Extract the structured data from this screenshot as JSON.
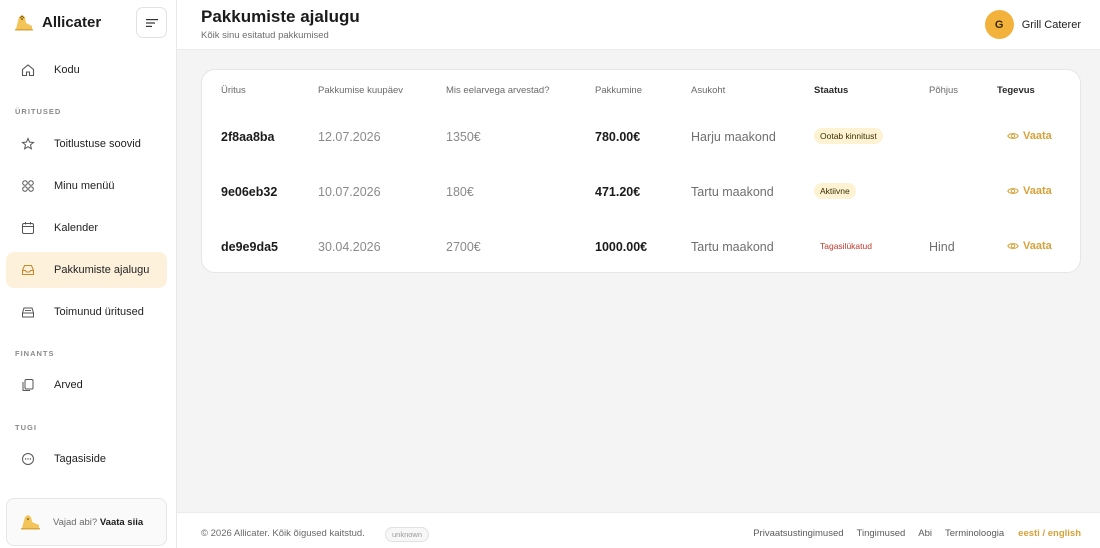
{
  "app": {
    "name": "Allicater"
  },
  "sidebar": {
    "items_top": [
      {
        "label": "Kodu",
        "icon": "home-icon"
      }
    ],
    "sections": [
      {
        "label": "ÜRITUSED",
        "items": [
          {
            "label": "Toitlustuse soovid",
            "icon": "star-icon"
          },
          {
            "label": "Minu menüü",
            "icon": "grid-icon"
          },
          {
            "label": "Kalender",
            "icon": "calendar-icon"
          },
          {
            "label": "Pakkumiste ajalugu",
            "icon": "inbox-icon",
            "active": true
          },
          {
            "label": "Toimunud üritused",
            "icon": "archive-icon"
          }
        ]
      },
      {
        "label": "FINANTS",
        "items": [
          {
            "label": "Arved",
            "icon": "copy-icon"
          }
        ]
      },
      {
        "label": "TUGI",
        "items": [
          {
            "label": "Tagasiside",
            "icon": "chat-icon"
          }
        ]
      }
    ],
    "help": {
      "prefix": "Vajad abi?",
      "link": "Vaata siia"
    }
  },
  "header": {
    "title": "Pakkumiste ajalugu",
    "subtitle": "Kõik sinu esitatud pakkumised",
    "user": {
      "initial": "G",
      "name": "Grill Caterer"
    }
  },
  "table": {
    "columns": [
      "Üritus",
      "Pakkumise kuupäev",
      "Mis eelarvega arvestad?",
      "Pakkumine",
      "Asukoht",
      "Staatus",
      "Põhjus",
      "Tegevus"
    ],
    "rows": [
      {
        "event": "2f8aa8ba",
        "date": "12.07.2026",
        "budget": "1350€",
        "offer": "780.00€",
        "location": "Harju maakond",
        "status": "Ootab kinnitust",
        "status_kind": "pending",
        "reason": "",
        "action": "Vaata"
      },
      {
        "event": "9e06eb32",
        "date": "10.07.2026",
        "budget": "180€",
        "offer": "471.20€",
        "location": "Tartu maakond",
        "status": "Aktiivne",
        "status_kind": "active",
        "reason": "",
        "action": "Vaata"
      },
      {
        "event": "de9e9da5",
        "date": "30.04.2026",
        "budget": "2700€",
        "offer": "1000.00€",
        "location": "Tartu maakond",
        "status": "Tagasilükatud",
        "status_kind": "rejected",
        "reason": "Hind",
        "action": "Vaata"
      }
    ]
  },
  "footer": {
    "copyright": "© 2026 Allicater. Kõik õigused kaitstud.",
    "version": "unknown",
    "links": [
      "Privaatsustingimused",
      "Tingimused",
      "Abi",
      "Terminoloogia"
    ],
    "language": "eesti / english"
  },
  "colors": {
    "accent": "#f2b23b",
    "action": "#d7a23a",
    "active_bg": "#fdf1dc",
    "rejected": "#c0392b"
  }
}
